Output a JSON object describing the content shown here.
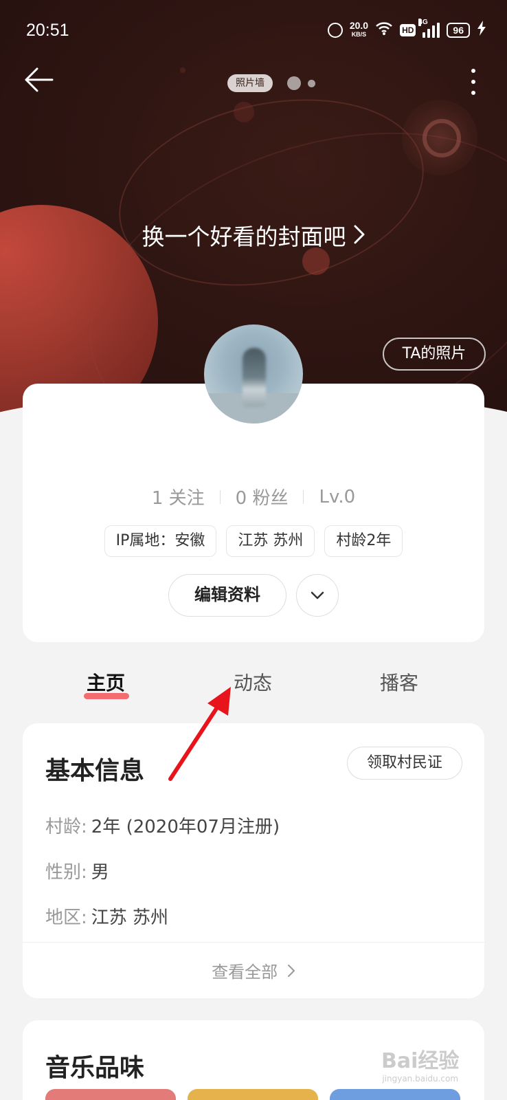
{
  "status_bar": {
    "time": "20:51",
    "net_speed": "20.0",
    "net_unit": "KB/S",
    "hd": "HD",
    "network": "4G",
    "battery": "96"
  },
  "header": {
    "photo_wall_label": "照片墙"
  },
  "cover": {
    "cta": "换一个好看的封面吧",
    "ta_photos": "TA的照片"
  },
  "profile": {
    "following": "1 关注",
    "followers": "0 粉丝",
    "level": "Lv.0",
    "tags": [
      "IP属地：安徽",
      "江苏 苏州",
      "村龄2年"
    ],
    "edit_label": "编辑资料"
  },
  "tabs": [
    "主页",
    "动态",
    "播客"
  ],
  "basic_info": {
    "title": "基本信息",
    "badge_button": "领取村民证",
    "rows": [
      {
        "label": "村龄:",
        "value": "2年 (2020年07月注册)"
      },
      {
        "label": "性别:",
        "value": "男"
      },
      {
        "label": "地区:",
        "value": "江苏 苏州"
      }
    ],
    "view_all": "查看全部"
  },
  "music": {
    "title": "音乐品味"
  },
  "watermark": {
    "text": "Bai经验",
    "sub": "jingyan.baidu.com"
  },
  "colors": {
    "accent": "#f2545b",
    "annotation_arrow": "#e8141b",
    "hero_bg": "#2c1411"
  }
}
